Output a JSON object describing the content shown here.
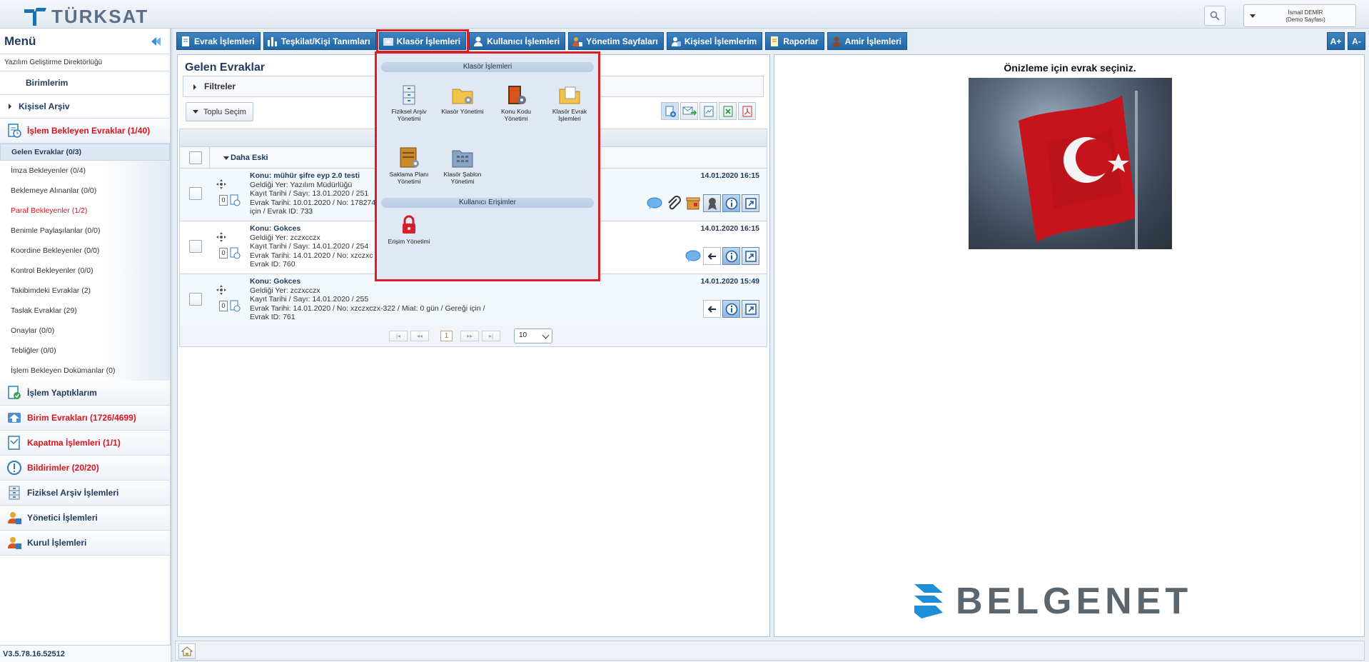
{
  "header": {
    "brand": "TÜRKSAT",
    "user_name": "İsmail DEMİR",
    "user_page": "(Demo Sayfası)"
  },
  "sidebar": {
    "menu_title": "Menü",
    "org": "Yazılım Geliştirme Direktörlüğü",
    "birimlerim": "Birimlerim",
    "kisisel_arsiv": "Kişisel Arşiv",
    "islem_bekleyen": "İşlem Bekleyen Evraklar (1/40)",
    "sub_items": [
      "Gelen Evraklar (0/3)",
      "İmza Bekleyenler (0/4)",
      "Beklemeye Alınanlar (0/0)",
      "Paraf Bekleyenler (1/2)",
      "Benimle Paylaşılanlar (0/0)",
      "Koordine Bekleyenler (0/0)",
      "Kontrol Bekleyenler (0/0)",
      "Takibimdeki Evraklar (2)",
      "Taslak Evraklar (29)",
      "Onaylar (0/0)",
      "Tebliğler (0/0)",
      "İşlem Bekleyen Dokümanlar (0)"
    ],
    "main_items": [
      "İşlem Yaptıklarım",
      "Birim Evrakları (1726/4699)",
      "Kapatma İşlemleri (1/1)",
      "Bildirimler (20/20)",
      "Fiziksel Arşiv İşlemleri",
      "Yönetici İşlemleri",
      "Kurul İşlemleri"
    ],
    "version": "V3.5.78.16.52512"
  },
  "topnav": {
    "tabs": [
      "Evrak İşlemleri",
      "Teşkilat/Kişi Tanımları",
      "Klasör İşlemleri",
      "Kullanıcı İşlemleri",
      "Yönetim Sayfaları",
      "Kişisel İşlemlerim",
      "Raporlar",
      "Amir İşlemleri"
    ],
    "font_up": "A+",
    "font_down": "A-"
  },
  "list": {
    "title": "Gelen Evraklar",
    "filters": "Filtreler",
    "toplu_secim": "Toplu Seçim",
    "group": "Daha Eski",
    "rows": [
      {
        "subject": "Konu: mühür şifre eyp 2.0 testi",
        "from": "Geldiği Yer: Yazılım Müdürlüğü",
        "kayit": "Kayıt Tarihi / Sayı: 13.01.2020 / 251",
        "evrak": "Evrak Tarihi: 10.01.2020 / No: 178274",
        "extra": "için / Evrak ID: 733",
        "date": "14.01.2020 16:15",
        "count": "0"
      },
      {
        "subject": "Konu: Gokces",
        "from": "Geldiği Yer: zczxcczx",
        "kayit": "Kayıt Tarihi / Sayı: 14.01.2020 / 254",
        "evrak": "Evrak Tarihi: 14.01.2020 / No: xzczxc",
        "extra": "Evrak ID: 760",
        "date": "14.01.2020 16:15",
        "count": "0"
      },
      {
        "subject": "Konu: Gokces",
        "from": "Geldiği Yer: zczxcczx",
        "kayit": "Kayıt Tarihi / Sayı: 14.01.2020 / 255",
        "evrak": "Evrak Tarihi: 14.01.2020 / No: xzczxczx-322 / Miat: 0 gün / Gereği için /",
        "extra": "Evrak ID: 761",
        "date": "14.01.2020 15:49",
        "count": "0"
      }
    ],
    "pager": {
      "first": "|◂",
      "prev": "◂◂",
      "current": "1",
      "next": "▸▸",
      "last": "▸|",
      "page_size": "10"
    }
  },
  "preview": {
    "title": "Önizleme için evrak seçiniz.",
    "brand": "BELGENET"
  },
  "dropdown": {
    "section1": "Klasör İşlemleri",
    "items": [
      "Fiziksel Arşiv Yönetimi",
      "Klasör Yönetimi",
      "Konu Kodu Yönetimi",
      "Klasör Evrak İşlemleri",
      "Saklama Planı Yönetimi",
      "Klasör Şablon Yönetimi"
    ],
    "section2": "Kullanıcı Erişimler",
    "access_item": "Erişim Yönetimi"
  },
  "colors": {
    "nav_blue": "#2b72b4",
    "highlight_red": "#d8202a",
    "alert_red": "#d9141c"
  }
}
